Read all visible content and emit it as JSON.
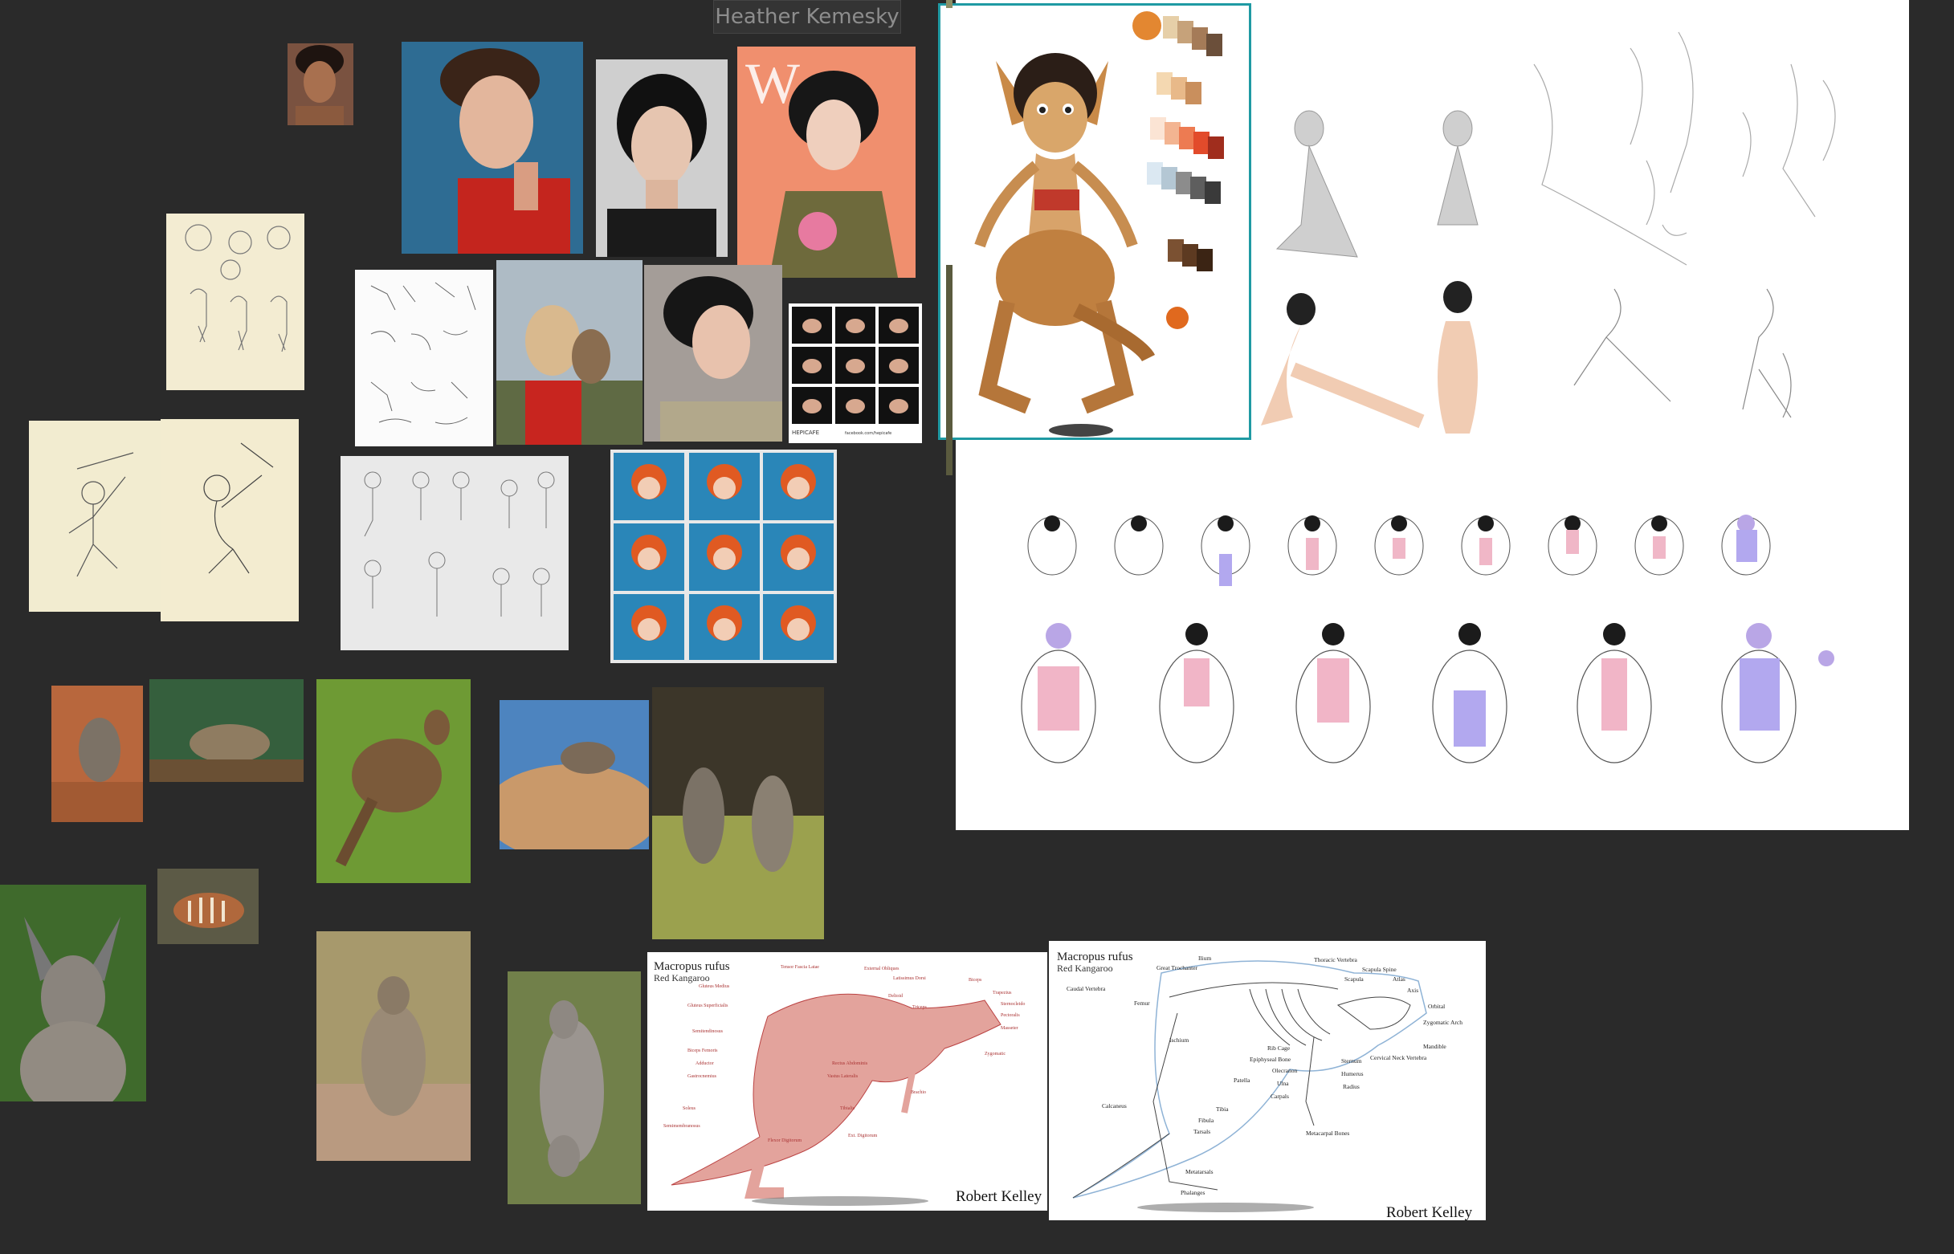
{
  "board": {
    "title": "Heather Kemesky",
    "accent_color": "#1f9aa3",
    "background_color": "#2a2a2a"
  },
  "anatomy_muscle": {
    "title": "Macropus rufus",
    "subtitle": "Red Kangaroo",
    "author": "Robert Kelley"
  },
  "anatomy_skeleton": {
    "title": "Macropus rufus",
    "subtitle": "Red Kangaroo",
    "author": "Robert Kelley"
  },
  "muscle_labels": [
    "Gluteus Medius",
    "Tensor Fascia Latae",
    "External Obliques",
    "Latissimus Dorsi",
    "Gluteus Superficialis",
    "Biceps",
    "Deltoid",
    "Triceps",
    "Trapezius",
    "Sternocleido",
    "Pectoralis",
    "Masseter",
    "Semitendinosus",
    "Gastrocnemius",
    "Biceps Femoris",
    "Soleus",
    "Tibialis",
    "Ext. Digitorum",
    "Flexor Digitorum",
    "Semimembranosus",
    "Rectus Abdominis",
    "Vastus Lateralis",
    "Adductor",
    "Brachio",
    "Zygomatic"
  ],
  "bone_labels": [
    "Ilium",
    "Thoracic Vertebra",
    "Scapula Spine",
    "Great Trochanter",
    "Scapula",
    "Atlas",
    "Caudal Vertebra",
    "Axis",
    "Femur",
    "Orbital",
    "Zygomatic Arch",
    "Ischium",
    "Rib Cage",
    "Mandible",
    "Epiphyseal Bone",
    "Sternum",
    "Olecranon",
    "Humerus",
    "Cervical Neck Vertebra",
    "Patella",
    "Ulna",
    "Radius",
    "Calcaneus",
    "Carpals",
    "Tibia",
    "Fibula",
    "Metacarpal Bones",
    "Tarsals",
    "Metatarsals",
    "Phalanges"
  ],
  "reference_badge": {
    "lines": [
      "HEPICAFE",
      "facebook.com/hepicafe"
    ]
  }
}
